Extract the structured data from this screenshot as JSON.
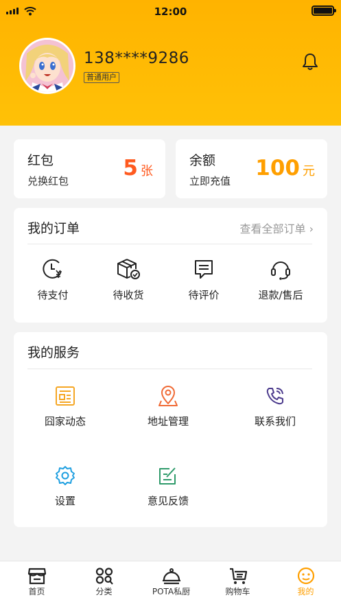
{
  "status_bar": {
    "time": "12:00"
  },
  "profile": {
    "phone": "138****9286",
    "user_type": "普通用户"
  },
  "wallet": {
    "red_packet": {
      "title": "红包",
      "action": "兑换红包",
      "count": "5",
      "unit": "张",
      "color": "#ff5a1f"
    },
    "balance": {
      "title": "余额",
      "action": "立即充值",
      "amount": "100",
      "unit": "元",
      "color": "#ff9f00"
    }
  },
  "orders": {
    "title": "我的订单",
    "view_all": "查看全部订单 ›",
    "items": [
      {
        "label": "待支付",
        "icon": "clock-yen-icon"
      },
      {
        "label": "待收货",
        "icon": "package-check-icon"
      },
      {
        "label": "待评价",
        "icon": "comment-icon"
      },
      {
        "label": "退款/售后",
        "icon": "headset-icon"
      }
    ]
  },
  "services": {
    "title": "我的服务",
    "items": [
      {
        "label": "囧家动态",
        "icon": "news-icon",
        "color": "#f5a623"
      },
      {
        "label": "地址管理",
        "icon": "location-icon",
        "color": "#f06a35"
      },
      {
        "label": "联系我们",
        "icon": "phone-icon",
        "color": "#4b3a8c"
      },
      {
        "label": "设置",
        "icon": "gear-icon",
        "color": "#1e9fe0"
      },
      {
        "label": "意见反馈",
        "icon": "feedback-icon",
        "color": "#2e9a6a"
      }
    ]
  },
  "tabbar": {
    "active_color": "#ff9f00",
    "items": [
      {
        "label": "首页",
        "icon": "store-icon"
      },
      {
        "label": "分类",
        "icon": "category-icon"
      },
      {
        "label": "POTA私厨",
        "icon": "cloche-icon"
      },
      {
        "label": "购物车",
        "icon": "cart-icon"
      },
      {
        "label": "我的",
        "icon": "smile-icon",
        "active": true
      }
    ]
  }
}
